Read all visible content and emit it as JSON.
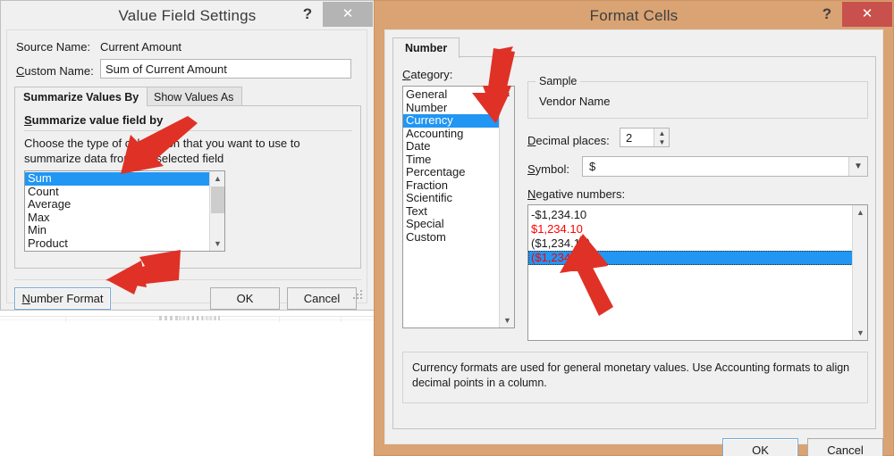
{
  "value_field_settings": {
    "title": "Value Field Settings",
    "help_label": "?",
    "close_label": "✕",
    "source_name_label": "Source Name:",
    "source_name_value": "Current Amount",
    "custom_name_label": "Custom Name:",
    "custom_name_value": "Sum of Current Amount",
    "tabs": [
      {
        "label": "Summarize Values By",
        "active": true
      },
      {
        "label": "Show Values As",
        "active": false
      }
    ],
    "panel_heading": "Summarize value field by",
    "panel_description": "Choose the type of calculation that you want to use to summarize data from the selected field",
    "summarize_options": [
      "Sum",
      "Count",
      "Average",
      "Max",
      "Min",
      "Product"
    ],
    "summarize_selected": "Sum",
    "buttons": {
      "number_format": "Number Format",
      "ok": "OK",
      "cancel": "Cancel"
    }
  },
  "format_cells": {
    "title": "Format Cells",
    "help_label": "?",
    "close_label": "✕",
    "tabs": [
      {
        "label": "Number",
        "active": true
      }
    ],
    "category_label": "Category:",
    "categories": [
      "General",
      "Number",
      "Currency",
      "Accounting",
      "Date",
      "Time",
      "Percentage",
      "Fraction",
      "Scientific",
      "Text",
      "Special",
      "Custom"
    ],
    "category_selected": "Currency",
    "sample_label": "Sample",
    "sample_value": "Vendor Name",
    "decimal_places_label": "Decimal places:",
    "decimal_places_value": "2",
    "symbol_label": "Symbol:",
    "symbol_value": "$",
    "negative_numbers_label": "Negative numbers:",
    "negative_numbers": [
      {
        "text": "-$1,234.10",
        "color": "#1a1a1a",
        "selected": false
      },
      {
        "text": "$1,234.10",
        "color": "#ff0000",
        "selected": false
      },
      {
        "text": "($1,234.10)",
        "color": "#1a1a1a",
        "selected": false
      },
      {
        "text": "($1,234.10)",
        "color": "#ff0000",
        "selected": true
      }
    ],
    "description": "Currency formats are used for general monetary values.  Use Accounting formats to align decimal points in a column.",
    "buttons": {
      "ok": "OK",
      "cancel": "Cancel"
    }
  },
  "annotations": {
    "arrow_color": "#e03127",
    "arrows": [
      {
        "name": "arrow-to-summarize-list"
      },
      {
        "name": "arrow-to-number-format-button"
      },
      {
        "name": "arrow-to-currency-category"
      },
      {
        "name": "arrow-to-negative-number-option"
      }
    ]
  },
  "colors": {
    "selection_blue": "#2196f3",
    "format_cells_frame": "#d9a373",
    "close_red": "#c8504d",
    "negative_red": "#ff0000"
  }
}
